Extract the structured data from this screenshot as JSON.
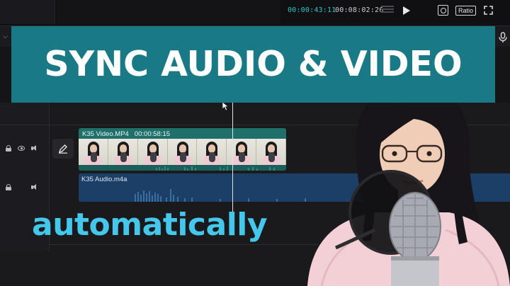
{
  "player": {
    "current_time": "00:00:43:11",
    "total_time": "00:08:02:26",
    "ratio_label": "Ratio"
  },
  "banner": {
    "title": "SYNC AUDIO & VIDEO",
    "background": "#197a85"
  },
  "timeline": {
    "video_clip": {
      "name": "K35 Video.MP4",
      "duration": "00:00:58:15",
      "color": "#1f6f6b"
    },
    "audio_clip": {
      "name": "K35 Audio.m4a",
      "color": "#1b3f67"
    }
  },
  "subtitle": {
    "text": "automatically",
    "color": "#45c7ec"
  },
  "icons": [
    "screenshot-icon",
    "fullscreen-icon",
    "play-icon",
    "mic-icon",
    "lock-icon",
    "eye-icon",
    "speaker-icon",
    "edit-icon"
  ],
  "accent": "#2bc4c8"
}
